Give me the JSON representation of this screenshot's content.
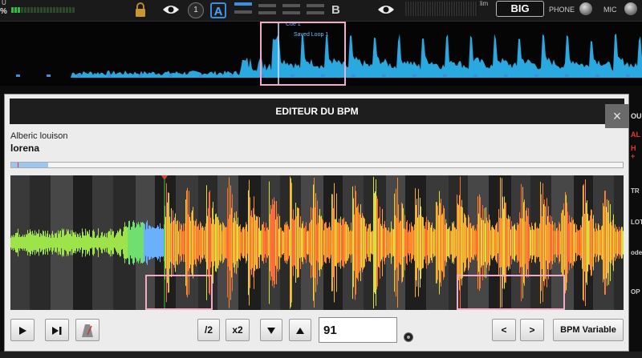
{
  "toolbar": {
    "u_label": "U",
    "pct_label": "%",
    "lock_icon": "lock-icon",
    "eye_icon": "eye-icon",
    "deck_number": "1",
    "deck_a": "A",
    "deck_b": "B",
    "lim_label": "lim",
    "big_label": "BIG",
    "phone_label": "PHONE",
    "mic_label": "MIC"
  },
  "overview": {
    "cue_label": "Cue 1",
    "loop_label": "Saved Loop 1",
    "wave_color": "#2aa8e0"
  },
  "background_deck": {
    "right_fragments": [
      "OU",
      "AL",
      "H +",
      "TR",
      "LOT",
      "ode",
      "OP"
    ]
  },
  "modal": {
    "title": "EDITEUR DU BPM",
    "close_label": "×",
    "artist": "Alberic louison",
    "track": "lorena",
    "progress_fraction": 0.06,
    "controls": {
      "play_icon": "play-icon",
      "skip_end_icon": "skip-end-icon",
      "metronome_icon": "metronome-icon",
      "half_label": "/2",
      "double_label": "x2",
      "down_icon": "triangle-down-icon",
      "up_icon": "triangle-up-icon",
      "bpm_value": "91",
      "prev_label": "<",
      "next_label": ">",
      "bpm_variable_label": "BPM Variable"
    }
  },
  "colors": {
    "accent_blue": "#3b8fe0",
    "highlight_pink": "#f5a9c8",
    "beat_marker_red": "#e0402a"
  }
}
